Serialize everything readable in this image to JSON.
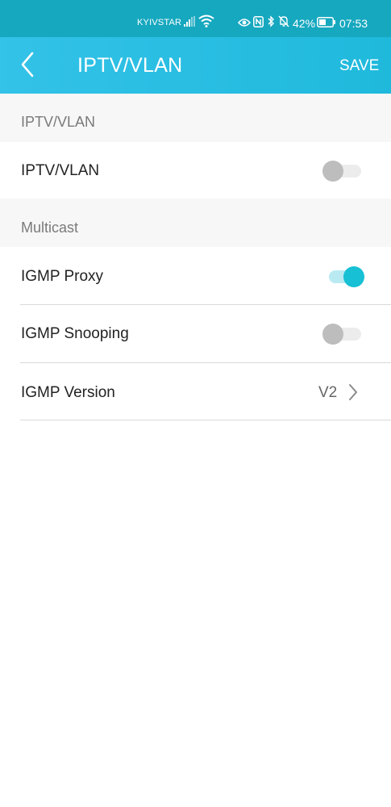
{
  "status_bar": {
    "carrier": "KYIVSTAR",
    "battery": "42%",
    "time": "07:53"
  },
  "header": {
    "title": "IPTV/VLAN",
    "save_label": "SAVE"
  },
  "sections": {
    "iptv": {
      "header": "IPTV/VLAN",
      "toggle_label": "IPTV/VLAN",
      "toggle_on": false
    },
    "multicast": {
      "header": "Multicast",
      "igmp_proxy_label": "IGMP Proxy",
      "igmp_proxy_on": true,
      "igmp_snooping_label": "IGMP Snooping",
      "igmp_snooping_on": false,
      "igmp_version_label": "IGMP Version",
      "igmp_version_value": "V2"
    }
  },
  "colors": {
    "accent": "#17c0d4",
    "header_bg": "#33c2e8",
    "status_bar_bg": "#16a8bf"
  }
}
